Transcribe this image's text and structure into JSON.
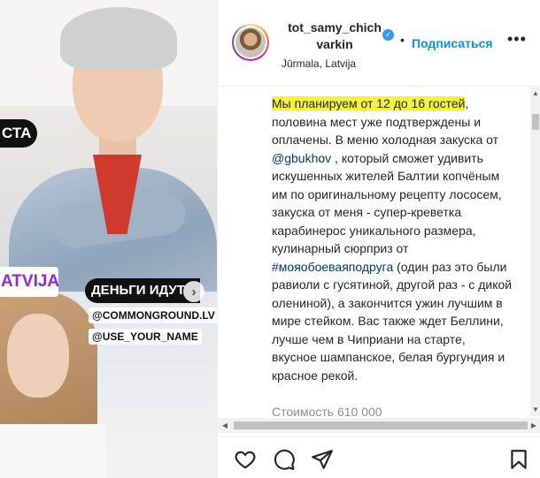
{
  "media": {
    "stickers": {
      "black_label": "СТА",
      "purple_label": "ATVIJA",
      "money_label": "ДЕНЬГИ ИДУТ",
      "tag1": "@COMMONGROUND.LV",
      "tag2": "@USE_YOUR_NAME"
    },
    "next_icon": "chevron-right-icon"
  },
  "header": {
    "username": "tot_samy_chich varkin",
    "verified_icon": "verified-badge-icon",
    "dot": "•",
    "subscribe_label": "Подписаться",
    "more_icon": "more-options-icon",
    "location": "Jūrmala, Latvija"
  },
  "caption": {
    "highlighted": "Мы планируем от 12 до 16 гостей",
    "part1": ", половина мест уже подтверждены и оплачены. В меню холодная закуска от ",
    "mention": "@gbukhov",
    "part2": " , который сможет удивить искушенных жителей Балтии копчёным им по оригинальному рецепту лососем, закуска от меня - супер-креветка карабинерос уникального размера, кулинарный сюрприз от ",
    "hashtag": "#мояобоеваяподруга",
    "part3": " (один раз это были равиоли с гусятиной, другой раз - с дикой олениной), а закончится ужин лучшим в мире стейком. Вас также ждет Беллини, лучше чем в Чиприани на старте, вкусное шампанское, белая бургундия и красное рекой.",
    "tail": "Стоимость 610 000"
  },
  "actions": {
    "like_icon": "heart-icon",
    "comment_icon": "comment-icon",
    "share_icon": "share-icon",
    "save_icon": "bookmark-icon"
  },
  "colors": {
    "accent": "#0095f6",
    "highlight": "#f4f23a",
    "link": "#00376b",
    "verified": "#3897f0"
  }
}
